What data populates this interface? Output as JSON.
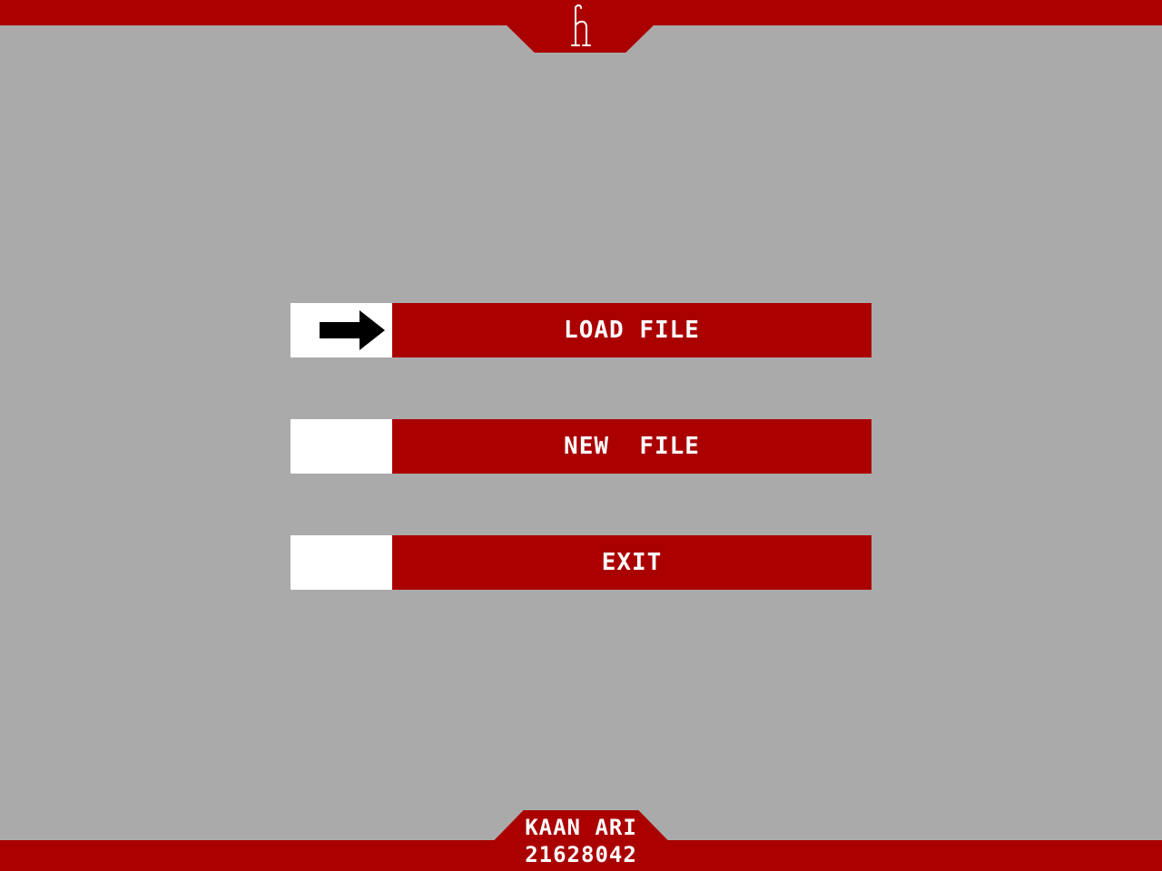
{
  "colors": {
    "background": "#aaaaaa",
    "accent": "#aa0000",
    "selector": "#ffffff",
    "text": "#ffffff",
    "arrow": "#000000"
  },
  "header": {
    "logo_icon": "h-glyph-logo-icon"
  },
  "menu": {
    "selected_index": 0,
    "items": [
      {
        "label": "LOAD FILE"
      },
      {
        "label": "NEW  FILE"
      },
      {
        "label": "EXIT"
      }
    ]
  },
  "footer": {
    "name": "KAAN ARI",
    "id": "21628042"
  }
}
